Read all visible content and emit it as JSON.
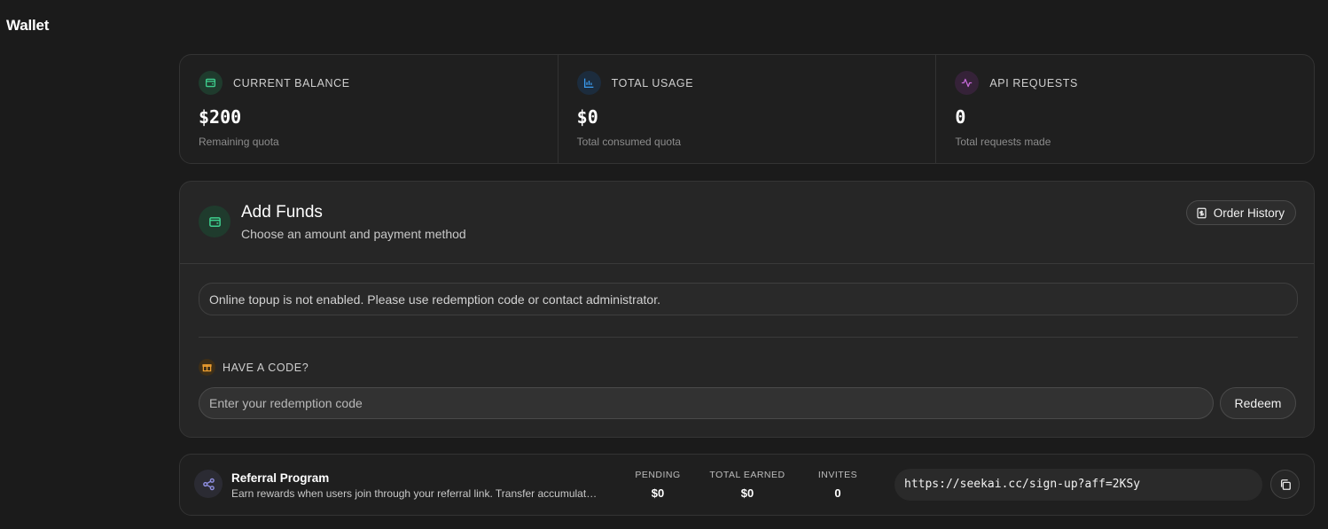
{
  "page": {
    "title": "Wallet"
  },
  "stats": [
    {
      "label": "CURRENT BALANCE",
      "value": "$200",
      "sub": "Remaining quota",
      "icon": "wallet-icon",
      "color": "#3ecf8e"
    },
    {
      "label": "TOTAL USAGE",
      "value": "$0",
      "sub": "Total consumed quota",
      "icon": "bar-chart-icon",
      "color": "#3b9cf0"
    },
    {
      "label": "API REQUESTS",
      "value": "0",
      "sub": "Total requests made",
      "icon": "activity-icon",
      "color": "#c66ad8"
    }
  ],
  "funds": {
    "title": "Add Funds",
    "subtitle": "Choose an amount and payment method",
    "order_history_label": "Order History",
    "notice": "Online topup is not enabled. Please use redemption code or contact administrator.",
    "code_label": "HAVE A CODE?",
    "code_placeholder": "Enter your redemption code",
    "redeem_label": "Redeem"
  },
  "referral": {
    "title": "Referral Program",
    "description": "Earn rewards when users join through your referral link. Transfer accumulated rewards to your balance.",
    "stats": [
      {
        "label": "PENDING",
        "value": "$0"
      },
      {
        "label": "TOTAL EARNED",
        "value": "$0"
      },
      {
        "label": "INVITES",
        "value": "0"
      }
    ],
    "link": "https://seekai.cc/sign-up?aff=2KSy"
  },
  "colors": {
    "background": "#1b1b1b",
    "accent_green": "#3ecf8e",
    "accent_orange": "#f0a030"
  }
}
